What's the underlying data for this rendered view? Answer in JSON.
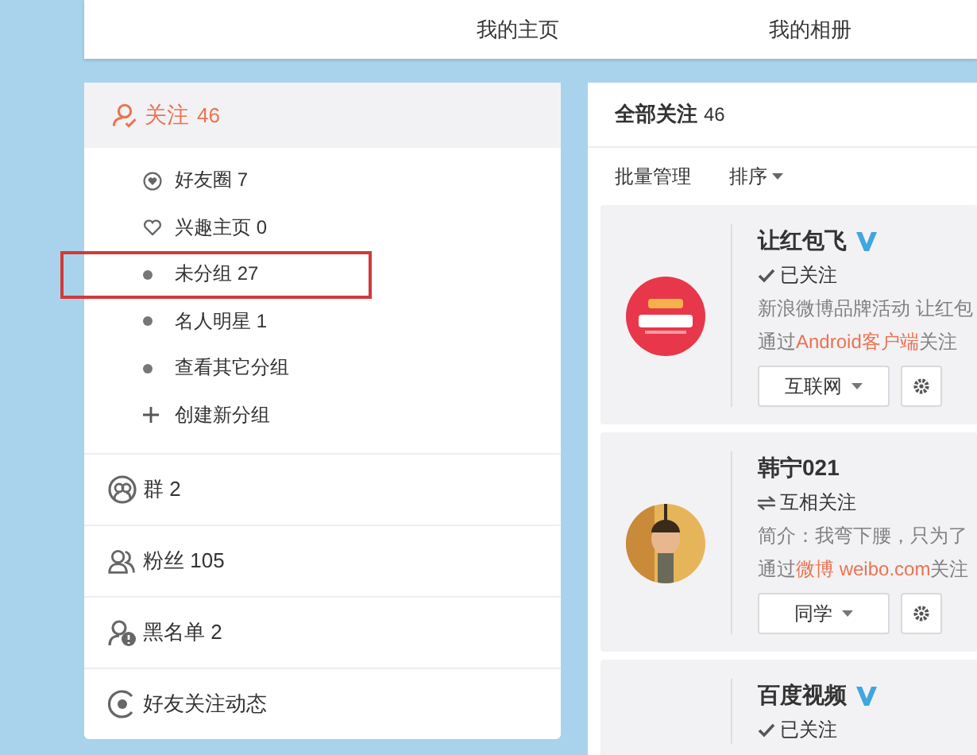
{
  "top_nav": [
    {
      "label": "我的主页"
    },
    {
      "label": "我的相册"
    }
  ],
  "sidebar": {
    "header": {
      "label": "关注",
      "count": "46",
      "selected": true
    },
    "groups": [
      {
        "kind": "heart-circle",
        "label": "好友圈",
        "count": "7",
        "highlighted": false
      },
      {
        "kind": "heart-outline",
        "label": "兴趣主页",
        "count": "0",
        "highlighted": false
      },
      {
        "kind": "dot",
        "label": "未分组",
        "count": "27",
        "highlighted": true
      },
      {
        "kind": "dot",
        "label": "名人明星",
        "count": "1",
        "highlighted": false
      },
      {
        "kind": "dot",
        "label": "查看其它分组",
        "highlighted": false
      },
      {
        "kind": "plus",
        "label": "创建新分组",
        "highlighted": false
      }
    ],
    "sections": [
      {
        "kind": "group",
        "label": "群",
        "count": "2"
      },
      {
        "kind": "fans",
        "label": "粉丝",
        "count": "105"
      },
      {
        "kind": "blacklist",
        "label": "黑名单",
        "count": "2"
      },
      {
        "kind": "feed",
        "label": "好友关注动态"
      }
    ]
  },
  "main": {
    "title": "全部关注",
    "count": "46",
    "toolbar": [
      {
        "label": "批量管理",
        "dropdown": false
      },
      {
        "label": "排序",
        "dropdown": true
      }
    ],
    "cards": [
      {
        "name": "让红包飞",
        "verified": true,
        "relation": {
          "kind": "followed",
          "label": "已关注"
        },
        "bio": "新浪微博品牌活动 让红包",
        "source_prefix": "通过",
        "source_link": "Android客户端",
        "source_suffix": "关注",
        "group": "互联网"
      },
      {
        "name": "韩宁021",
        "verified": false,
        "relation": {
          "kind": "mutual",
          "label": "互相关注"
        },
        "bio": "简介：我弯下腰，只为了",
        "source_prefix": "通过",
        "source_link": "微博 weibo.com",
        "source_suffix": "关注",
        "group": "同学"
      },
      {
        "name": "百度视频",
        "verified": true,
        "relation": {
          "kind": "followed",
          "label": "已关注"
        }
      }
    ]
  }
}
